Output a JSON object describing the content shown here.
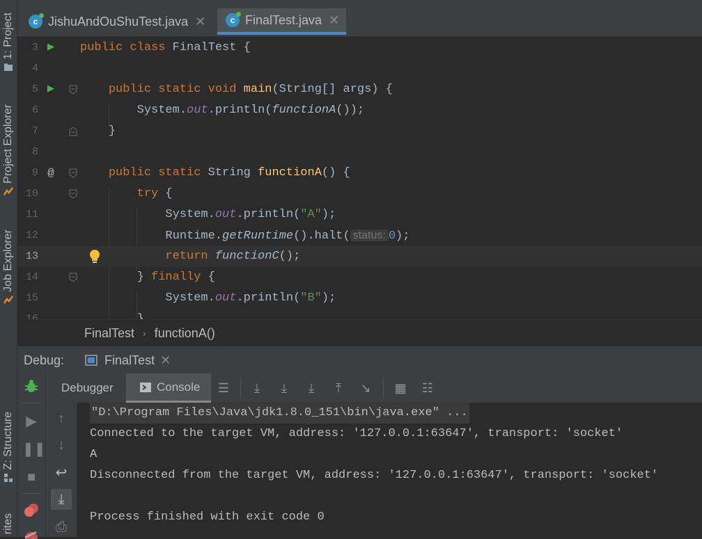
{
  "left_strip": {
    "project_label": "1: Project",
    "project_explorer_label": "Project Explorer",
    "job_explorer_label": "Job Explorer",
    "structure_label": "Z: Structure",
    "favorites_label": "rites"
  },
  "tabs": [
    {
      "label": "JishuAndOuShuTest.java",
      "active": false
    },
    {
      "label": "FinalTest.java",
      "active": true
    }
  ],
  "editor": {
    "lines": [
      {
        "num": "3"
      },
      {
        "num": "4"
      },
      {
        "num": "5"
      },
      {
        "num": "6"
      },
      {
        "num": "7"
      },
      {
        "num": "8"
      },
      {
        "num": "9"
      },
      {
        "num": "10"
      },
      {
        "num": "11"
      },
      {
        "num": "12"
      },
      {
        "num": "13"
      },
      {
        "num": "14"
      },
      {
        "num": "15"
      },
      {
        "num": "16"
      }
    ],
    "tokens": {
      "public": "public",
      "class": "class",
      "class_name": "FinalTest {",
      "static": "static",
      "void": "void",
      "main": "main",
      "main_args": "(String[] args) {",
      "system": "System.",
      "out": "out",
      "println_open": ".println(",
      "functionA_call": "functionA",
      "call_close": "());",
      "close_brace": "}",
      "string_type": "String",
      "functionA_decl": "functionA",
      "decl_parens": "() {",
      "try": "try",
      "open_brace": " {",
      "str_a": "\"A\"",
      "str_b": "\"B\"",
      "paren_semi": ");",
      "runtime": "Runtime.",
      "getRuntime": "getRuntime",
      "halt": "().halt(",
      "hint_status": "status:",
      "zero": "0",
      "return": "return",
      "functionC": "functionC",
      "call_semi": "();",
      "finally_close": "} ",
      "finally": "finally",
      "partial": "}"
    }
  },
  "breadcrumb": {
    "class": "FinalTest",
    "method": "functionA()"
  },
  "debug": {
    "label": "Debug:",
    "session_tab": "FinalTest",
    "debugger_tab": "Debugger",
    "console_tab": "Console"
  },
  "console": {
    "lines": [
      "\"D:\\Program Files\\Java\\jdk1.8.0_151\\bin\\java.exe\" ...",
      "Connected to the target VM, address: '127.0.0.1:63647', transport: 'socket'",
      "A",
      "Disconnected from the target VM, address: '127.0.0.1:63647', transport: 'socket'",
      "",
      "Process finished with exit code 0"
    ]
  },
  "colors": {
    "background": "#2b2b2b",
    "panel": "#3c3f41",
    "keyword": "#cc7832",
    "method": "#ffc66d",
    "field": "#9876aa",
    "string": "#6a8759",
    "number": "#6897bb",
    "accent": "#4a88c7"
  },
  "icons": [
    "run-icon",
    "override-icon",
    "bulb-icon",
    "bug-icon",
    "resume-icon",
    "pause-icon",
    "stop-icon",
    "breakpoints-icon",
    "mute-icon",
    "up-arrow-icon",
    "down-arrow-icon",
    "soft-wrap-icon",
    "scroll-end-icon",
    "print-icon"
  ]
}
